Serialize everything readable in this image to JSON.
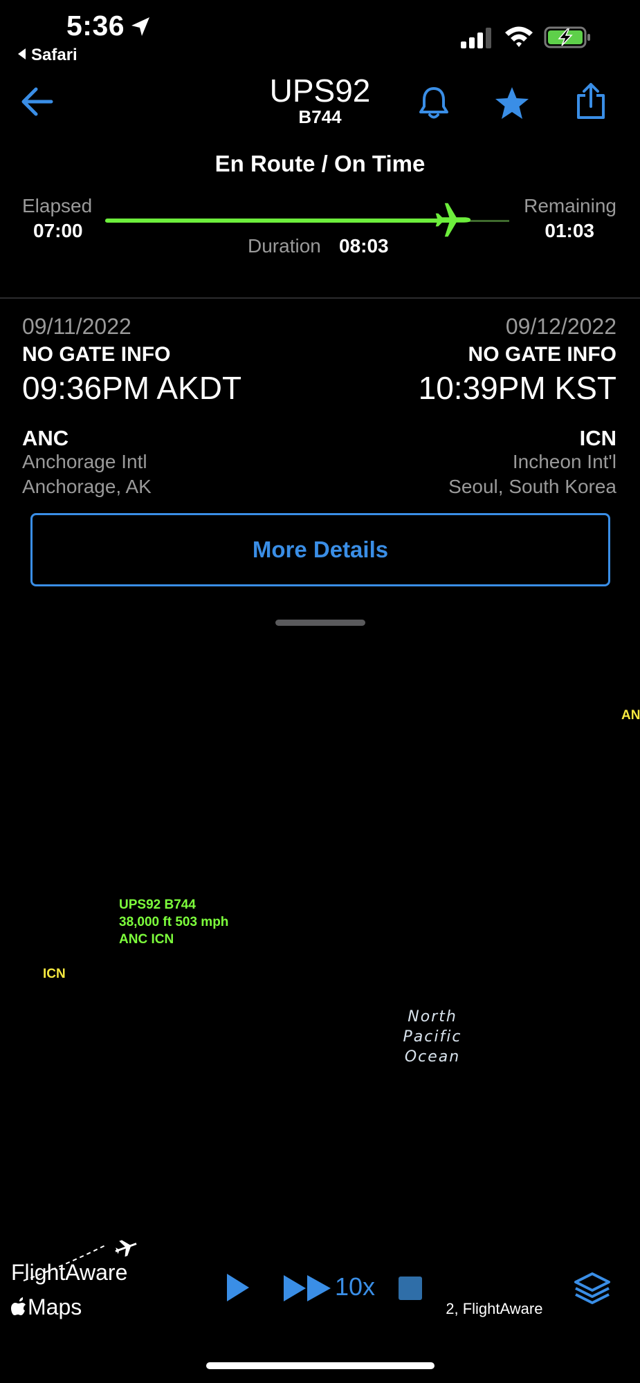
{
  "status_bar": {
    "time": "5:36",
    "back_app": "Safari"
  },
  "header": {
    "flight_ident": "UPS92",
    "aircraft_type": "B744",
    "icons": [
      "back-arrow-icon",
      "bell-icon",
      "star-icon",
      "share-icon"
    ]
  },
  "flight_status": "En Route / On Time",
  "progress": {
    "elapsed_label": "Elapsed",
    "elapsed_value": "07:00",
    "remaining_label": "Remaining",
    "remaining_value": "01:03",
    "duration_label": "Duration",
    "duration_value": "08:03",
    "fraction_complete": 0.87
  },
  "departure": {
    "date": "09/11/2022",
    "gate": "NO GATE INFO",
    "time": "09:36PM AKDT",
    "code": "ANC",
    "airport": "Anchorage Intl",
    "city": "Anchorage, AK"
  },
  "arrival": {
    "date": "09/12/2022",
    "gate": "NO GATE INFO",
    "time": "10:39PM KST",
    "code": "ICN",
    "airport": "Incheon Int'l",
    "city": "Seoul, South Korea"
  },
  "more_details_label": "More Details",
  "map": {
    "flight_tag": {
      "line1": "UPS92 B744",
      "line2": "38,000 ft 503 mph",
      "line3": "ANC ICN"
    },
    "anc_label": "AN",
    "icn_label": "ICN",
    "ocean": {
      "line1": "North",
      "line2": "Pacific",
      "line3": "Ocean"
    },
    "brand": "FlightAware",
    "maps_label": "Maps",
    "copyright": "22, FlightAware",
    "colors": {
      "track": "#6dee3c",
      "planned": "#9a9a9a",
      "label": "#f6e940",
      "accent": "#3a8ee6"
    }
  },
  "playback": {
    "speed": "10x"
  }
}
